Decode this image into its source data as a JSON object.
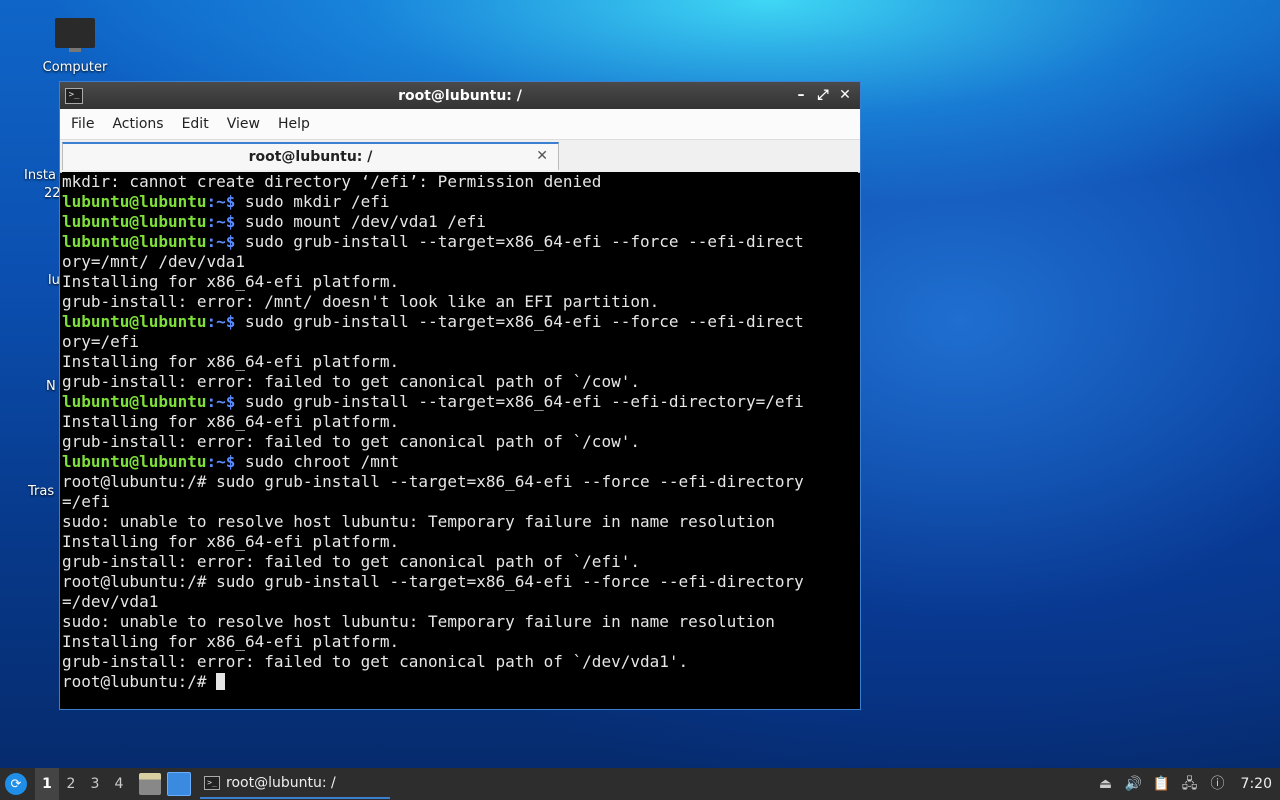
{
  "desktop": {
    "computer_label": "Computer",
    "partial_labels": [
      "Insta",
      "22",
      "lu",
      "N",
      "Tras"
    ]
  },
  "window": {
    "title": "root@lubuntu: /",
    "menu": [
      "File",
      "Actions",
      "Edit",
      "View",
      "Help"
    ],
    "tab_label": "root@lubuntu: /",
    "controls": {
      "minimize": "–",
      "maximize": "⤢",
      "close": "✕"
    }
  },
  "terminal": {
    "lines": [
      {
        "text": "mkdir: cannot create directory ‘/efi’: Permission denied"
      },
      {
        "user": "lubuntu@lubuntu",
        "path": ":~$",
        "cmd": " sudo mkdir /efi"
      },
      {
        "user": "lubuntu@lubuntu",
        "path": ":~$",
        "cmd": " sudo mount /dev/vda1 /efi"
      },
      {
        "user": "lubuntu@lubuntu",
        "path": ":~$",
        "cmd": " sudo grub-install --target=x86_64-efi --force --efi-direct"
      },
      {
        "text": "ory=/mnt/ /dev/vda1"
      },
      {
        "text": "Installing for x86_64-efi platform."
      },
      {
        "text": "grub-install: error: /mnt/ doesn't look like an EFI partition."
      },
      {
        "user": "lubuntu@lubuntu",
        "path": ":~$",
        "cmd": " sudo grub-install --target=x86_64-efi --force --efi-direct"
      },
      {
        "text": "ory=/efi"
      },
      {
        "text": "Installing for x86_64-efi platform."
      },
      {
        "text": "grub-install: error: failed to get canonical path of `/cow'."
      },
      {
        "user": "lubuntu@lubuntu",
        "path": ":~$",
        "cmd": " sudo grub-install --target=x86_64-efi --efi-directory=/efi"
      },
      {
        "text": "Installing for x86_64-efi platform."
      },
      {
        "text": "grub-install: error: failed to get canonical path of `/cow'."
      },
      {
        "user": "lubuntu@lubuntu",
        "path": ":~$",
        "cmd": " sudo chroot /mnt"
      },
      {
        "text": "root@lubuntu:/# sudo grub-install --target=x86_64-efi --force --efi-directory"
      },
      {
        "text": "=/efi"
      },
      {
        "text": "sudo: unable to resolve host lubuntu: Temporary failure in name resolution"
      },
      {
        "text": "Installing for x86_64-efi platform."
      },
      {
        "text": "grub-install: error: failed to get canonical path of `/efi'."
      },
      {
        "text": "root@lubuntu:/# sudo grub-install --target=x86_64-efi --force --efi-directory"
      },
      {
        "text": "=/dev/vda1"
      },
      {
        "text": "sudo: unable to resolve host lubuntu: Temporary failure in name resolution"
      },
      {
        "text": "Installing for x86_64-efi platform."
      },
      {
        "text": "grub-install: error: failed to get canonical path of `/dev/vda1'."
      }
    ],
    "final_prompt": "root@lubuntu:/# "
  },
  "taskbar": {
    "workspaces": [
      "1",
      "2",
      "3",
      "4"
    ],
    "active_workspace": "1",
    "task_label": "root@lubuntu: /",
    "clock": "7:20"
  },
  "colors": {
    "prompt_user": "#7ee03a",
    "prompt_path": "#5b8cff",
    "accent": "#3a7fd0"
  }
}
